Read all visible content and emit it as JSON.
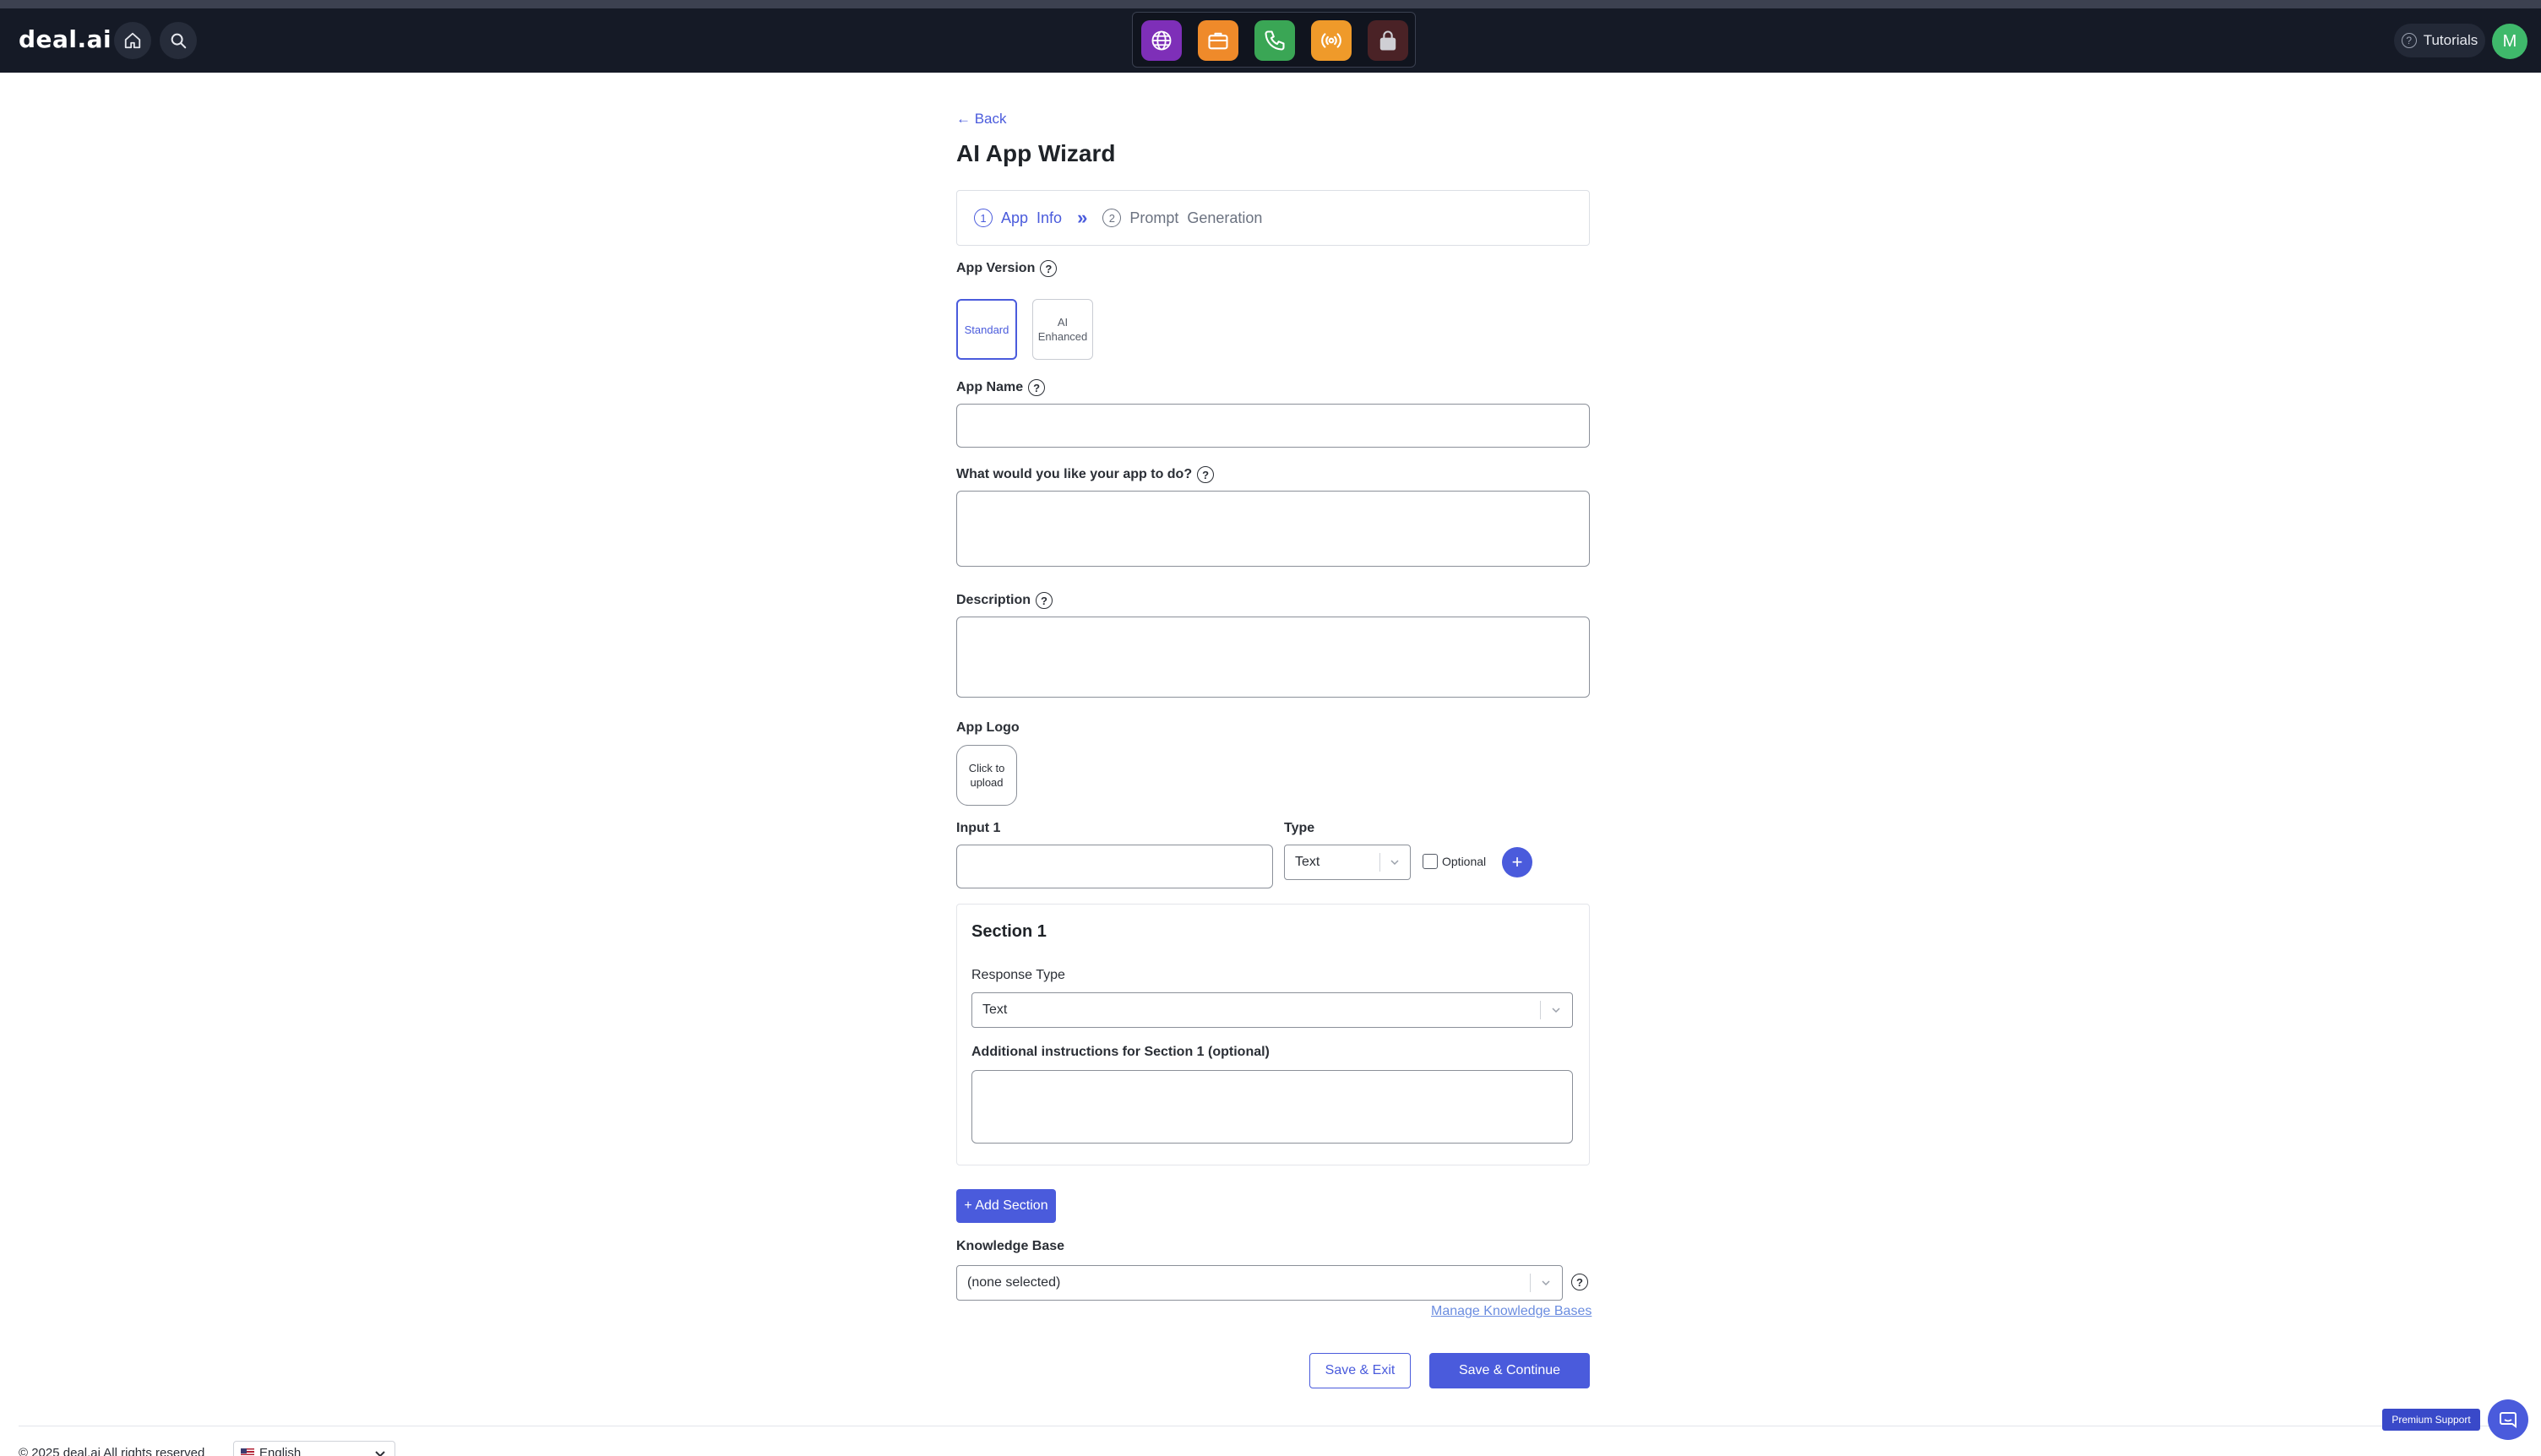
{
  "brand": "deal.ai",
  "header": {
    "tutorials_label": "Tutorials",
    "avatar_initial": "M",
    "dock_apps": [
      {
        "icon": "globe-icon",
        "color": "#7e2fb8"
      },
      {
        "icon": "briefcase-icon",
        "color": "#ef8a2a"
      },
      {
        "icon": "phone-icon",
        "color": "#3aa655"
      },
      {
        "icon": "broadcast-icon",
        "color": "#ef9a2a"
      },
      {
        "icon": "lock-icon",
        "color": "#4a2226"
      }
    ]
  },
  "page": {
    "back_label": "← Back",
    "title": "AI App Wizard",
    "steps": [
      {
        "number": "1",
        "label": "App  Info",
        "active": true
      },
      {
        "number": "2",
        "label": "Prompt  Generation",
        "active": false
      }
    ]
  },
  "form": {
    "app_version_label": "App Version",
    "version_options": [
      {
        "label": "Standard",
        "selected": true
      },
      {
        "label": "AI Enhanced",
        "selected": false
      }
    ],
    "app_name_label": "App Name",
    "app_name_value": "",
    "purpose_label": "What would you like your app to do?",
    "purpose_value": "",
    "description_label": "Description",
    "description_value": "",
    "app_logo_label": "App Logo",
    "logo_upload_text": "Click to upload",
    "input1_label": "Input 1",
    "input1_value": "",
    "type_label": "Type",
    "type_value": "Text",
    "optional_label": "Optional",
    "optional_checked": false,
    "add_input_label": "+"
  },
  "section": {
    "title": "Section 1",
    "response_type_label": "Response Type",
    "response_type_value": "Text",
    "instructions_label": "Additional instructions for Section 1 (optional)",
    "instructions_value": ""
  },
  "actions": {
    "add_section_label": "+ Add Section",
    "knowledge_base_label": "Knowledge Base",
    "knowledge_base_value": "(none selected)",
    "manage_kb_label": "Manage Knowledge Bases",
    "save_exit_label": "Save & Exit",
    "save_continue_label": "Save & Continue"
  },
  "footer": {
    "copyright": "© 2025 deal.ai All rights reserved",
    "language": "English",
    "premium_support_label": "Premium Support"
  },
  "colors": {
    "accent": "#4a5bdc",
    "nav_bg": "#151a26",
    "avatar": "#3fb96b"
  }
}
